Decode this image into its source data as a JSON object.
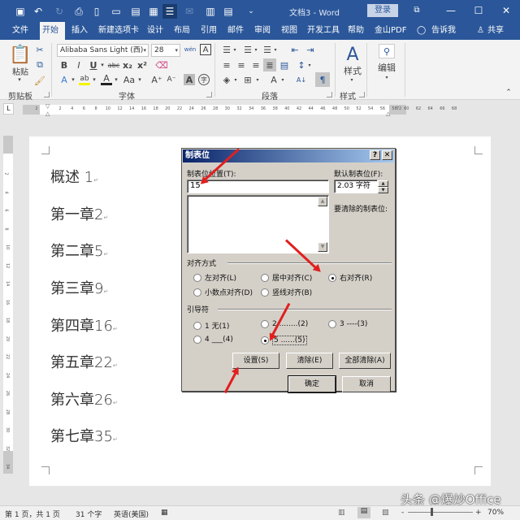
{
  "window": {
    "title": "文档3  -  Word",
    "login_label": "登录",
    "controls": {
      "ribbon_display": "⧉",
      "minimize": "—",
      "maximize": "☐",
      "close": "✕"
    }
  },
  "quick_access": [
    {
      "name": "save-icon",
      "glyph": "💾"
    },
    {
      "name": "undo-icon",
      "glyph": "↶"
    },
    {
      "name": "redo-icon",
      "glyph": "↻"
    },
    {
      "name": "print-preview-icon",
      "glyph": "🔍"
    },
    {
      "name": "new-document-icon",
      "glyph": "▯"
    },
    {
      "name": "open-folder-icon",
      "glyph": "📂"
    },
    {
      "name": "paste-icon",
      "glyph": "📋"
    },
    {
      "name": "screenshot-icon",
      "glyph": "▣"
    },
    {
      "name": "document-view-icon",
      "glyph": "☰"
    },
    {
      "name": "mail-icon",
      "glyph": "✉"
    },
    {
      "name": "columns-icon",
      "glyph": "▥"
    },
    {
      "name": "paste-options-icon",
      "glyph": "📋"
    },
    {
      "name": "customize-qat-icon",
      "glyph": "⌄"
    }
  ],
  "tabs": [
    "文件",
    "开始",
    "插入",
    "新建选项卡",
    "设计",
    "布局",
    "引用",
    "邮件",
    "审阅",
    "视图",
    "开发工具",
    "帮助",
    "金山PDF",
    "告诉我",
    "共享"
  ],
  "active_tab": "开始",
  "ribbon": {
    "clipboard": {
      "paste_label": "粘贴",
      "group_label": "剪贴板"
    },
    "font": {
      "font_name": "Alibaba Sans Light (西)",
      "font_size": "28",
      "group_label": "字体",
      "buttons": [
        "B",
        "I",
        "U",
        "abc",
        "x₂",
        "x²",
        "A",
        "ab",
        "A",
        "Aa",
        "A⁺",
        "A⁻",
        "A",
        "字"
      ]
    },
    "paragraph": {
      "group_label": "段落"
    },
    "styles": {
      "label": "样式",
      "group_label": "样式"
    },
    "editing": {
      "label": "编辑"
    }
  },
  "ruler": {
    "left_margin": "2",
    "ticks": [
      "2",
      "4",
      "6",
      "8",
      "10",
      "12",
      "14",
      "16",
      "18",
      "20",
      "22",
      "24",
      "26",
      "28",
      "30",
      "32",
      "34",
      "36",
      "38",
      "40",
      "42",
      "44",
      "46",
      "48",
      "50",
      "52",
      "54",
      "56",
      "58",
      "60",
      "62",
      "64",
      "66",
      "68"
    ],
    "right_margin": "72",
    "vertical_ticks": [
      "2",
      "4",
      "6",
      "8",
      "10",
      "12",
      "14",
      "16",
      "18",
      "20",
      "22",
      "24",
      "26",
      "28",
      "30",
      "32",
      "34"
    ]
  },
  "document": {
    "lines": [
      "概述 1",
      "第一章2",
      "第二章5",
      "第三章9",
      "第四章16",
      "第五章22",
      "第六章26",
      "第七章35"
    ]
  },
  "dialog": {
    "title": "制表位",
    "help_btn": "?",
    "close_btn": "✕",
    "tab_position_label": "制表位位置(T):",
    "tab_position_value": "15",
    "default_tab_label": "默认制表位(F):",
    "default_tab_value": "2.03 字符",
    "clear_label": "要清除的制表位:",
    "alignment_label": "对齐方式",
    "alignment_options": [
      {
        "label": "左对齐(L)",
        "selected": false
      },
      {
        "label": "居中对齐(C)",
        "selected": false
      },
      {
        "label": "右对齐(R)",
        "selected": true
      },
      {
        "label": "小数点对齐(D)",
        "selected": false
      },
      {
        "label": "竖线对齐(B)",
        "selected": false
      }
    ],
    "leader_label": "引导符",
    "leader_options": [
      {
        "label": "1 无(1)",
        "selected": false
      },
      {
        "label": "2 ........(2)",
        "selected": false
      },
      {
        "label": "3 ----(3)",
        "selected": false
      },
      {
        "label": "4 ___(4)",
        "selected": false
      },
      {
        "label": "5 ......(5)",
        "selected": true
      }
    ],
    "buttons": {
      "set": "设置(S)",
      "clear": "清除(E)",
      "clear_all": "全部清除(A)",
      "ok": "确定",
      "cancel": "取消"
    }
  },
  "statusbar": {
    "page": "第 1 页，共 1 页",
    "words": "31 个字",
    "language": "英语(美国)",
    "zoom": "70%",
    "zoom_minus": "-",
    "zoom_plus": "+"
  },
  "watermark": "头条 @爆炒Office",
  "colors": {
    "accent": "#2b579a",
    "dialog_bg": "#d4d0c8",
    "arrow": "#e02020"
  }
}
